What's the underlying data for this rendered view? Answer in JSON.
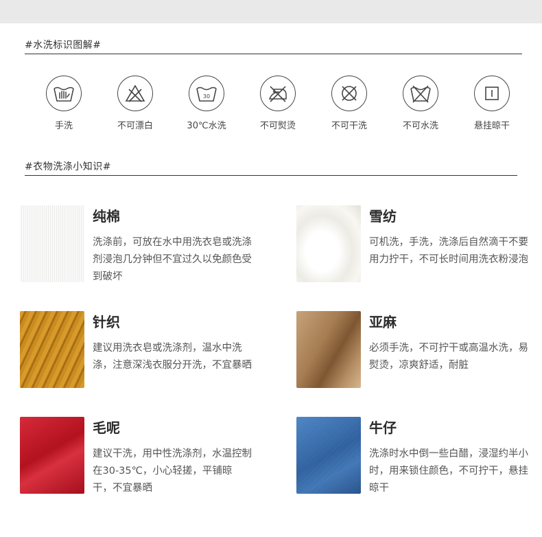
{
  "sections": {
    "care_symbols_title": "#水洗标识图解#",
    "tips_title": "#衣物洗涤小知识#"
  },
  "care_symbols": [
    {
      "icon": "hand-wash-icon",
      "label": "手洗"
    },
    {
      "icon": "no-bleach-icon",
      "label": "不可漂白"
    },
    {
      "icon": "wash-30-icon",
      "label": "30℃水洗",
      "temp": "30"
    },
    {
      "icon": "no-iron-icon",
      "label": "不可熨烫"
    },
    {
      "icon": "no-dry-clean-icon",
      "label": "不可干洗"
    },
    {
      "icon": "no-wash-icon",
      "label": "不可水洗"
    },
    {
      "icon": "hang-dry-icon",
      "label": "悬挂晾干"
    }
  ],
  "fabrics": [
    {
      "title": "纯棉",
      "desc": "洗涤前，可放在水中用洗衣皂或洗涤剂浸泡几分钟但不宜过久以免颜色受到破坏",
      "color": "#f1f1ef"
    },
    {
      "title": "雪纺",
      "desc": "可机洗，手洗，洗涤后自然滴干不要用力拧干，不可长时间用洗衣粉浸泡",
      "color": "#f4f3ee"
    },
    {
      "title": "针织",
      "desc": "建议用洗衣皂或洗涤剂，温水中洗涤，注意深浅衣服分开洗，不宜暴晒",
      "color": "#c98c21"
    },
    {
      "title": "亚麻",
      "desc": "必须手洗，不可拧干或高温水洗，易熨烫，凉爽舒适，耐脏",
      "color": "#a67d52"
    },
    {
      "title": "毛呢",
      "desc": "建议干洗，用中性洗涤剂，水温控制在30-35℃，小心轻搓，平铺晾干，不宜暴晒",
      "color": "#c41b2b"
    },
    {
      "title": "牛仔",
      "desc": "洗涤时水中倒一些白醋，浸湿约半小时，用来锁住颜色，不可拧干，悬挂晾干",
      "color": "#3a6fb0"
    }
  ]
}
